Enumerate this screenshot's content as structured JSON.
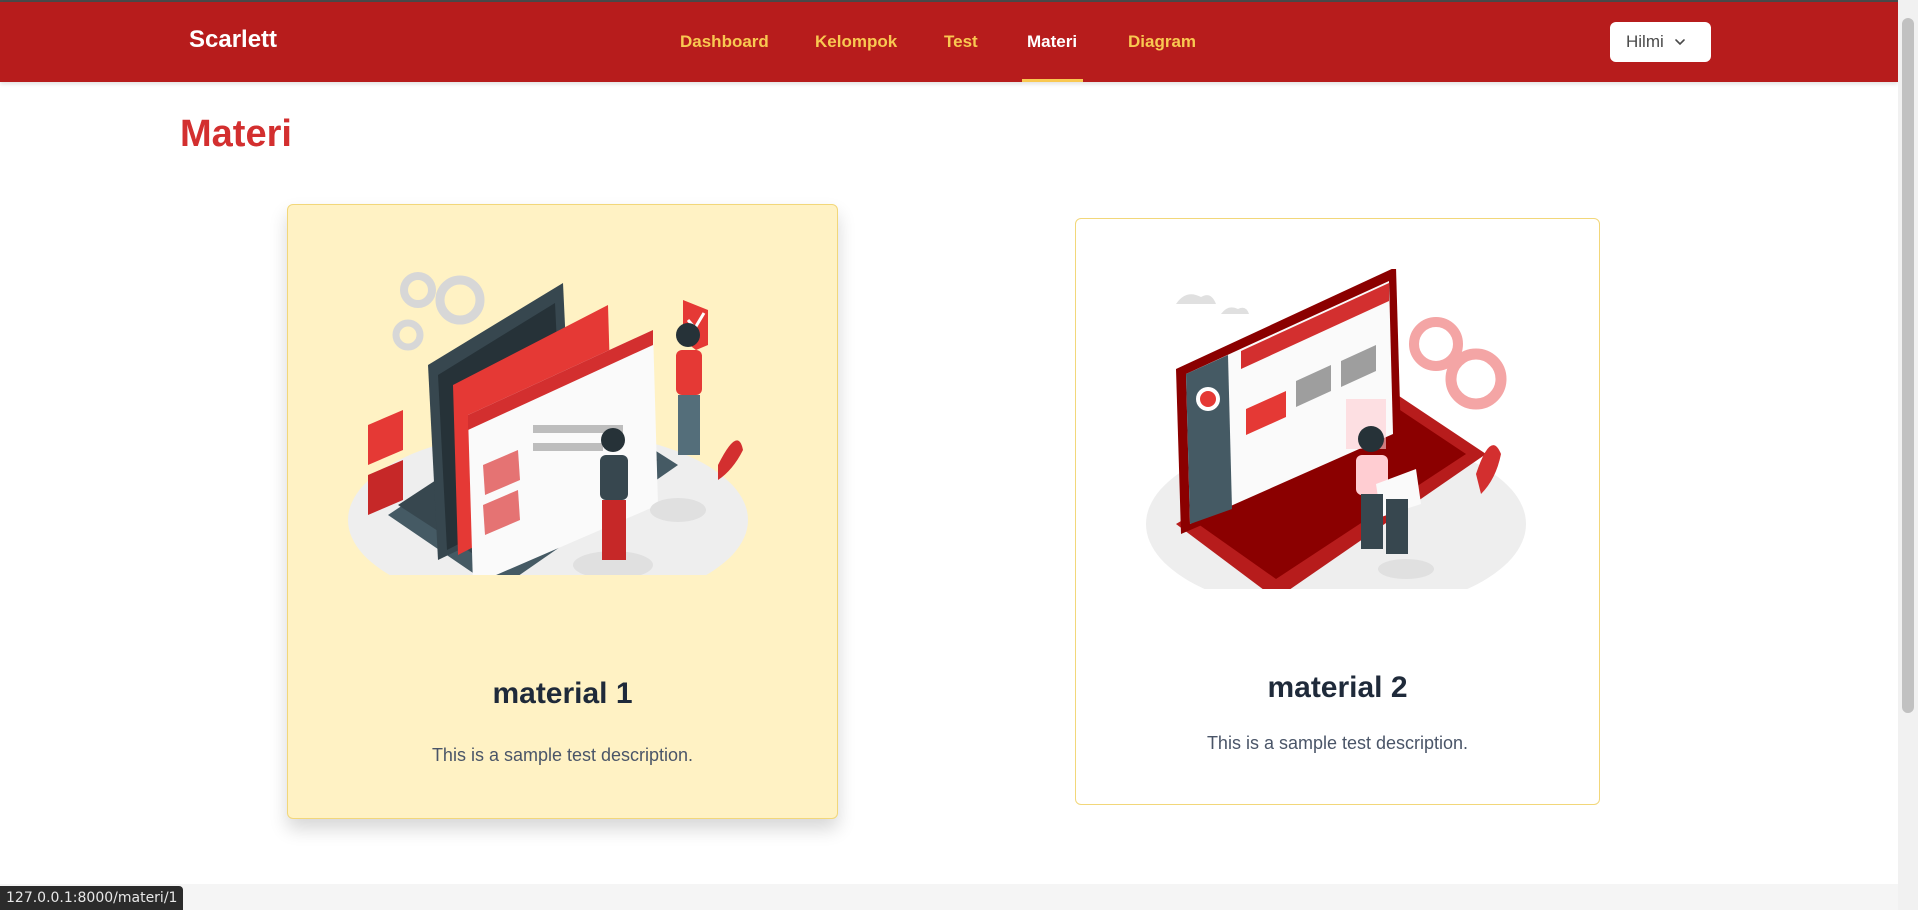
{
  "header": {
    "brand": "Scarlett",
    "nav": [
      {
        "label": "Dashboard",
        "active": false
      },
      {
        "label": "Kelompok",
        "active": false
      },
      {
        "label": "Test",
        "active": false
      },
      {
        "label": "Materi",
        "active": true
      },
      {
        "label": "Diagram",
        "active": false
      }
    ],
    "user": {
      "name": "Hilmi"
    }
  },
  "page": {
    "title": "Materi"
  },
  "materials": [
    {
      "title": "material 1",
      "description": "This is a sample test description."
    },
    {
      "title": "material 2",
      "description": "This is a sample test description."
    }
  ],
  "status_bar": {
    "url": "127.0.0.1:8000/materi/1"
  },
  "colors": {
    "navbar": "#b71c1c",
    "nav_link": "#f9c851",
    "title": "#d32f2f",
    "card_hover_bg": "#fff2c4",
    "card_border": "#f2d77a"
  }
}
